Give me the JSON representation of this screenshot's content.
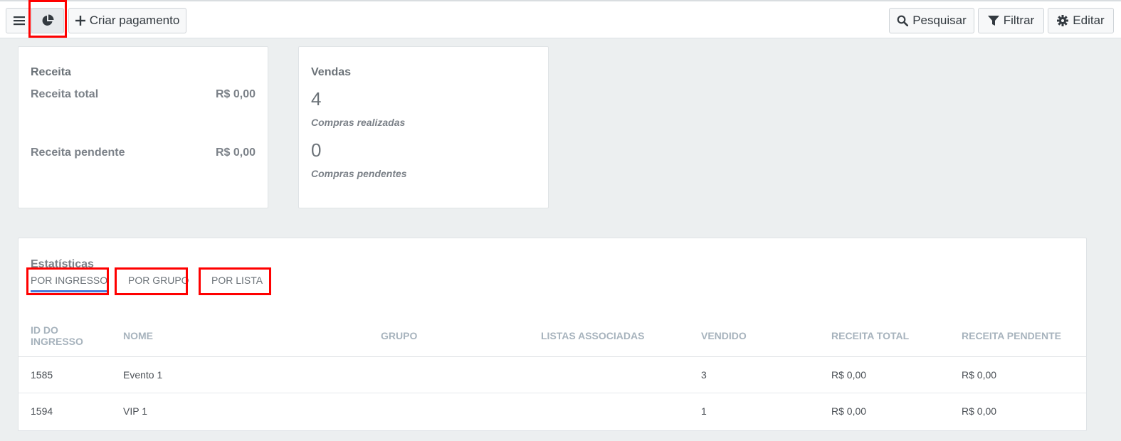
{
  "toolbar": {
    "menu_icon": "hamburger-menu-icon",
    "stats_icon": "pie-chart-icon",
    "create_label": "Criar pagamento",
    "search_label": "Pesquisar",
    "filter_label": "Filtrar",
    "edit_label": "Editar",
    "highlight_color": "#ff0000"
  },
  "revenue": {
    "title": "Receita",
    "total_label": "Receita total",
    "total_value": "R$ 0,00",
    "pending_label": "Receita pendente",
    "pending_value": "R$ 0,00"
  },
  "sales": {
    "title": "Vendas",
    "completed_count": "4",
    "completed_caption": "Compras realizadas",
    "pending_count": "0",
    "pending_caption": "Compras pendentes"
  },
  "stats": {
    "title": "Estatísticas",
    "tabs": [
      {
        "label": "POR INGRESSO",
        "active": true
      },
      {
        "label": "POR GRUPO",
        "active": false
      },
      {
        "label": "POR LISTA",
        "active": false
      }
    ],
    "columns": [
      "ID DO INGRESSO",
      "NOME",
      "GRUPO",
      "LISTAS ASSOCIADAS",
      "VENDIDO",
      "RECEITA TOTAL",
      "RECEITA PENDENTE"
    ],
    "rows": [
      [
        "1585",
        "Evento 1",
        "",
        "",
        "3",
        "R$ 0,00",
        "R$ 0,00"
      ],
      [
        "1594",
        "VIP 1",
        "",
        "",
        "1",
        "R$ 0,00",
        "R$ 0,00"
      ]
    ],
    "active_tab_color": "#4a78d8"
  }
}
